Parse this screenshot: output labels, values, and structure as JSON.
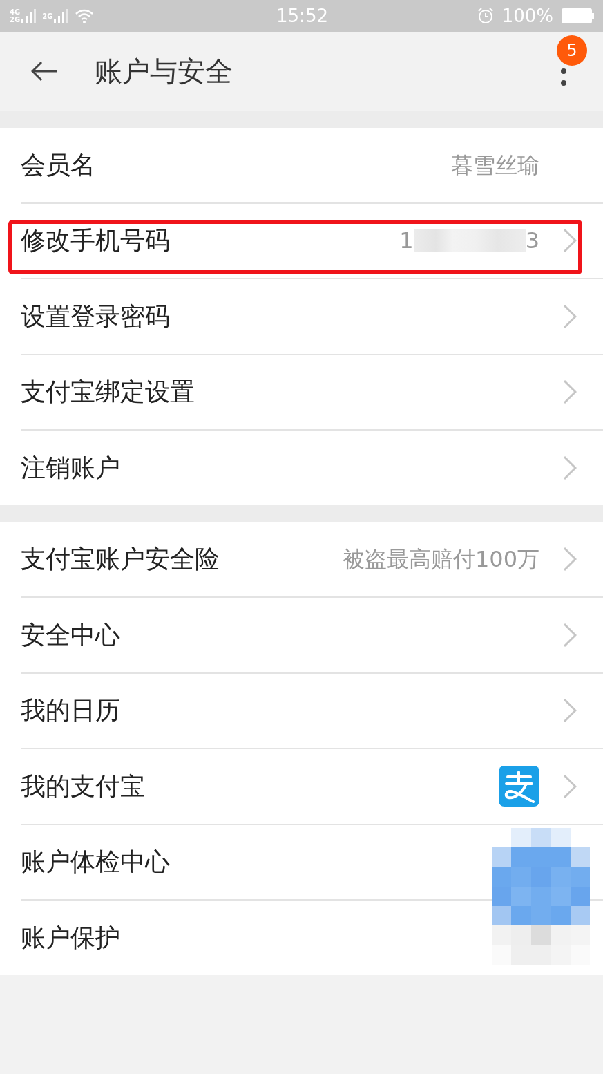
{
  "status_bar": {
    "sims": [
      {
        "labels": [
          "4G",
          "2G"
        ]
      },
      {
        "labels": [
          "2G"
        ]
      }
    ],
    "time": "15:52",
    "battery": "100%"
  },
  "header": {
    "title": "账户与安全",
    "badge": "5"
  },
  "groups": [
    {
      "mosaic_overlay": false,
      "rows": [
        {
          "kind": "value",
          "label": "会员名",
          "value": "暮雪丝瑜",
          "chevron": false,
          "highlighted": false
        },
        {
          "kind": "masked",
          "label": "修改手机号码",
          "value_start": "1",
          "value_end": "3",
          "chevron": true,
          "highlighted": true
        },
        {
          "kind": "plain",
          "label": "设置登录密码",
          "chevron": true,
          "highlighted": false
        },
        {
          "kind": "plain",
          "label": "支付宝绑定设置",
          "chevron": true,
          "highlighted": false
        },
        {
          "kind": "plain",
          "label": "注销账户",
          "chevron": true,
          "highlighted": false
        }
      ]
    },
    {
      "mosaic_overlay": true,
      "rows": [
        {
          "kind": "value",
          "label": "支付宝账户安全险",
          "value": "被盗最高赔付100万",
          "chevron": true,
          "highlighted": false
        },
        {
          "kind": "plain",
          "label": "安全中心",
          "chevron": true,
          "highlighted": false
        },
        {
          "kind": "plain",
          "label": "我的日历",
          "chevron": true,
          "highlighted": false
        },
        {
          "kind": "logo",
          "label": "我的支付宝",
          "chevron": true,
          "highlighted": false
        },
        {
          "kind": "plain",
          "label": "账户体检中心",
          "chevron": false,
          "highlighted": false
        },
        {
          "kind": "plain",
          "label": "账户保护",
          "chevron": false,
          "highlighted": false
        }
      ]
    }
  ]
}
